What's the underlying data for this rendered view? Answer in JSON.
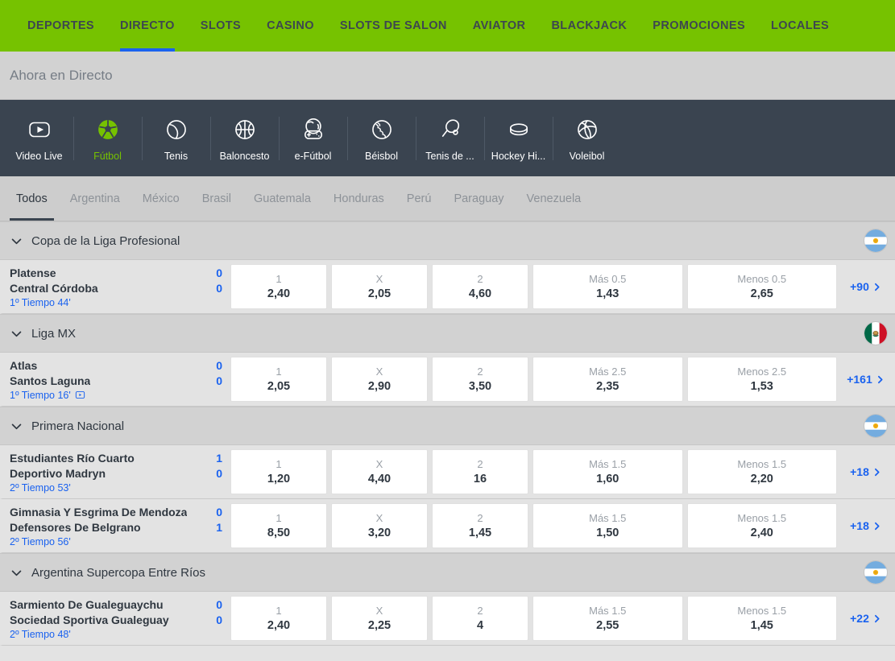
{
  "topnav": {
    "items": [
      {
        "label": "DEPORTES",
        "active": false
      },
      {
        "label": "DIRECTO",
        "active": true
      },
      {
        "label": "SLOTS",
        "active": false
      },
      {
        "label": "CASINO",
        "active": false
      },
      {
        "label": "SLOTS DE SALON",
        "active": false
      },
      {
        "label": "AVIATOR",
        "active": false
      },
      {
        "label": "BLACKJACK",
        "active": false
      },
      {
        "label": "PROMOCIONES",
        "active": false
      },
      {
        "label": "LOCALES",
        "active": false
      }
    ],
    "bg_color": "#76c200",
    "active_underline_color": "#1a62ef"
  },
  "titlebar": {
    "title": "Ahora en Directo"
  },
  "sports": {
    "items": [
      {
        "label": "Video Live",
        "icon": "video-play-icon",
        "active": false
      },
      {
        "label": "Fútbol",
        "icon": "soccer-ball-icon",
        "active": true
      },
      {
        "label": "Tenis",
        "icon": "tennis-ball-icon",
        "active": false
      },
      {
        "label": "Baloncesto",
        "icon": "basketball-icon",
        "active": false
      },
      {
        "label": "e-Fútbol",
        "icon": "esports-gamepad-icon",
        "active": false
      },
      {
        "label": "Béisbol",
        "icon": "baseball-icon",
        "active": false
      },
      {
        "label": "Tenis de ...",
        "icon": "table-tennis-icon",
        "active": false
      },
      {
        "label": "Hockey Hi...",
        "icon": "hockey-puck-icon",
        "active": false
      },
      {
        "label": "Voleibol",
        "icon": "volleyball-icon",
        "active": false
      }
    ],
    "bg_color": "#3a4450",
    "active_color": "#76c200"
  },
  "countries": {
    "tabs": [
      {
        "label": "Todos",
        "active": true
      },
      {
        "label": "Argentina",
        "active": false
      },
      {
        "label": "México",
        "active": false
      },
      {
        "label": "Brasil",
        "active": false
      },
      {
        "label": "Guatemala",
        "active": false
      },
      {
        "label": "Honduras",
        "active": false
      },
      {
        "label": "Perú",
        "active": false
      },
      {
        "label": "Paraguay",
        "active": false
      },
      {
        "label": "Venezuela",
        "active": false
      }
    ]
  },
  "leagues": [
    {
      "name": "Copa de la Liga Profesional",
      "flag": "argentina",
      "matches": [
        {
          "home": "Platense",
          "away": "Central Córdoba",
          "home_score": "0",
          "away_score": "0",
          "status": "1º Tiempo 44'",
          "has_video": false,
          "odds": [
            {
              "label": "1",
              "value": "2,40",
              "size": "sm"
            },
            {
              "label": "X",
              "value": "2,05",
              "size": "sm"
            },
            {
              "label": "2",
              "value": "4,60",
              "size": "sm"
            },
            {
              "label": "Más 0.5",
              "value": "1,43",
              "size": "lg"
            },
            {
              "label": "Menos 0.5",
              "value": "2,65",
              "size": "lg"
            }
          ],
          "more": "+90"
        }
      ]
    },
    {
      "name": "Liga MX",
      "flag": "mexico",
      "matches": [
        {
          "home": "Atlas",
          "away": "Santos Laguna",
          "home_score": "0",
          "away_score": "0",
          "status": "1º Tiempo 16'",
          "has_video": true,
          "odds": [
            {
              "label": "1",
              "value": "2,05",
              "size": "sm"
            },
            {
              "label": "X",
              "value": "2,90",
              "size": "sm"
            },
            {
              "label": "2",
              "value": "3,50",
              "size": "sm"
            },
            {
              "label": "Más 2.5",
              "value": "2,35",
              "size": "lg"
            },
            {
              "label": "Menos 2.5",
              "value": "1,53",
              "size": "lg"
            }
          ],
          "more": "+161"
        }
      ]
    },
    {
      "name": "Primera Nacional",
      "flag": "argentina",
      "matches": [
        {
          "home": "Estudiantes Río Cuarto",
          "away": "Deportivo Madryn",
          "home_score": "1",
          "away_score": "0",
          "status": "2º Tiempo 53'",
          "has_video": false,
          "odds": [
            {
              "label": "1",
              "value": "1,20",
              "size": "sm"
            },
            {
              "label": "X",
              "value": "4,40",
              "size": "sm"
            },
            {
              "label": "2",
              "value": "16",
              "size": "sm"
            },
            {
              "label": "Más 1.5",
              "value": "1,60",
              "size": "lg"
            },
            {
              "label": "Menos 1.5",
              "value": "2,20",
              "size": "lg"
            }
          ],
          "more": "+18"
        },
        {
          "home": "Gimnasia Y Esgrima De Mendoza",
          "away": "Defensores De Belgrano",
          "home_score": "0",
          "away_score": "1",
          "status": "2º Tiempo 56'",
          "has_video": false,
          "odds": [
            {
              "label": "1",
              "value": "8,50",
              "size": "sm"
            },
            {
              "label": "X",
              "value": "3,20",
              "size": "sm"
            },
            {
              "label": "2",
              "value": "1,45",
              "size": "sm"
            },
            {
              "label": "Más 1.5",
              "value": "1,50",
              "size": "lg"
            },
            {
              "label": "Menos 1.5",
              "value": "2,40",
              "size": "lg"
            }
          ],
          "more": "+18"
        }
      ]
    },
    {
      "name": "Argentina Supercopa Entre Ríos",
      "flag": "argentina",
      "matches": [
        {
          "home": "Sarmiento De Gualeguaychu",
          "away": "Sociedad Sportiva Gualeguay",
          "home_score": "0",
          "away_score": "0",
          "status": "2º Tiempo 48'",
          "has_video": false,
          "odds": [
            {
              "label": "1",
              "value": "2,40",
              "size": "sm"
            },
            {
              "label": "X",
              "value": "2,25",
              "size": "sm"
            },
            {
              "label": "2",
              "value": "4",
              "size": "sm"
            },
            {
              "label": "Más 1.5",
              "value": "2,55",
              "size": "lg"
            },
            {
              "label": "Menos 1.5",
              "value": "1,45",
              "size": "lg"
            }
          ],
          "more": "+22"
        }
      ]
    }
  ]
}
